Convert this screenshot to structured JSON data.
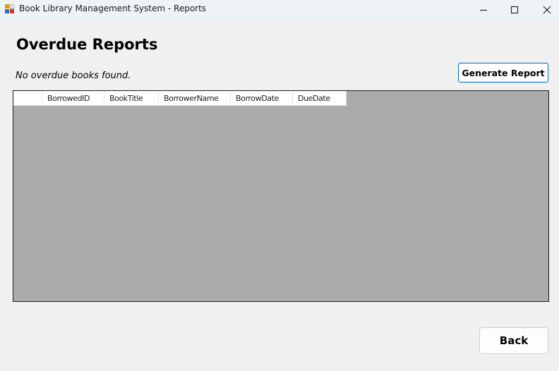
{
  "window": {
    "title": "Book Library Management System - Reports",
    "icon": "app-icon"
  },
  "page": {
    "title": "Overdue Reports",
    "status": "No overdue books found."
  },
  "actions": {
    "generate_label": "Generate Report",
    "back_label": "Back"
  },
  "grid": {
    "columns": [
      "BorrowedID",
      "BookTitle",
      "BorrowerName",
      "BorrowDate",
      "DueDate"
    ],
    "rows": [],
    "background_color": "#ababab"
  },
  "colors": {
    "accent": "#0067c0"
  }
}
